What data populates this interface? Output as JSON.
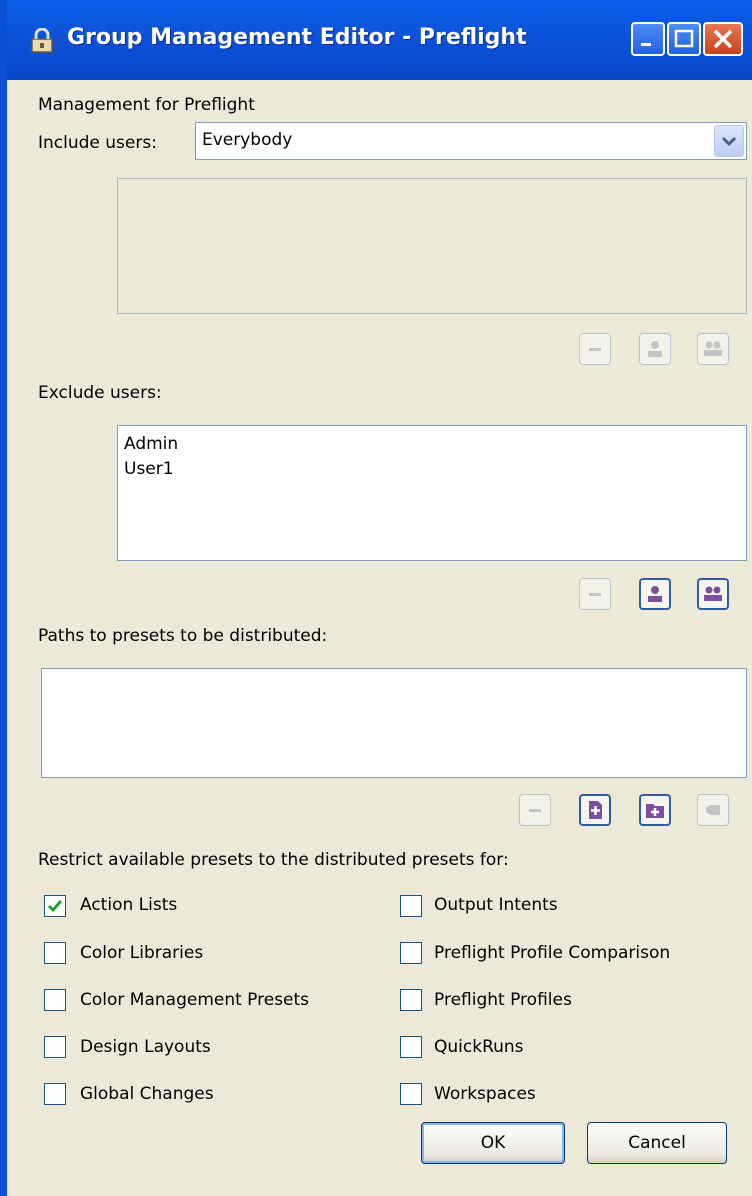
{
  "window": {
    "title": "Group Management Editor - Preflight",
    "colors": {
      "titlebar": "#0A5FEA",
      "background": "#ECE9D8",
      "accent_purple": "#7B4F9D"
    }
  },
  "header": {
    "management_label": "Management for Preflight"
  },
  "include": {
    "label": "Include users:",
    "selected": "Everybody",
    "dropdown_icon": "chevron-down-icon"
  },
  "exclude": {
    "label": "Exclude users:",
    "items": [
      "Admin",
      "User1"
    ]
  },
  "paths": {
    "label": "Paths to presets to be distributed:"
  },
  "restrict": {
    "label": "Restrict available presets to the distributed presets for:",
    "left": [
      {
        "label": "Action Lists",
        "checked": true
      },
      {
        "label": "Color Libraries",
        "checked": false
      },
      {
        "label": "Color Management Presets",
        "checked": false
      },
      {
        "label": "Design Layouts",
        "checked": false
      },
      {
        "label": "Global Changes",
        "checked": false
      }
    ],
    "right": [
      {
        "label": "Output Intents",
        "checked": false
      },
      {
        "label": "Preflight Profile Comparison",
        "checked": false
      },
      {
        "label": "Preflight Profiles",
        "checked": false
      },
      {
        "label": "QuickRuns",
        "checked": false
      },
      {
        "label": "Workspaces",
        "checked": false
      }
    ]
  },
  "buttons": {
    "ok": "OK",
    "cancel": "Cancel"
  }
}
